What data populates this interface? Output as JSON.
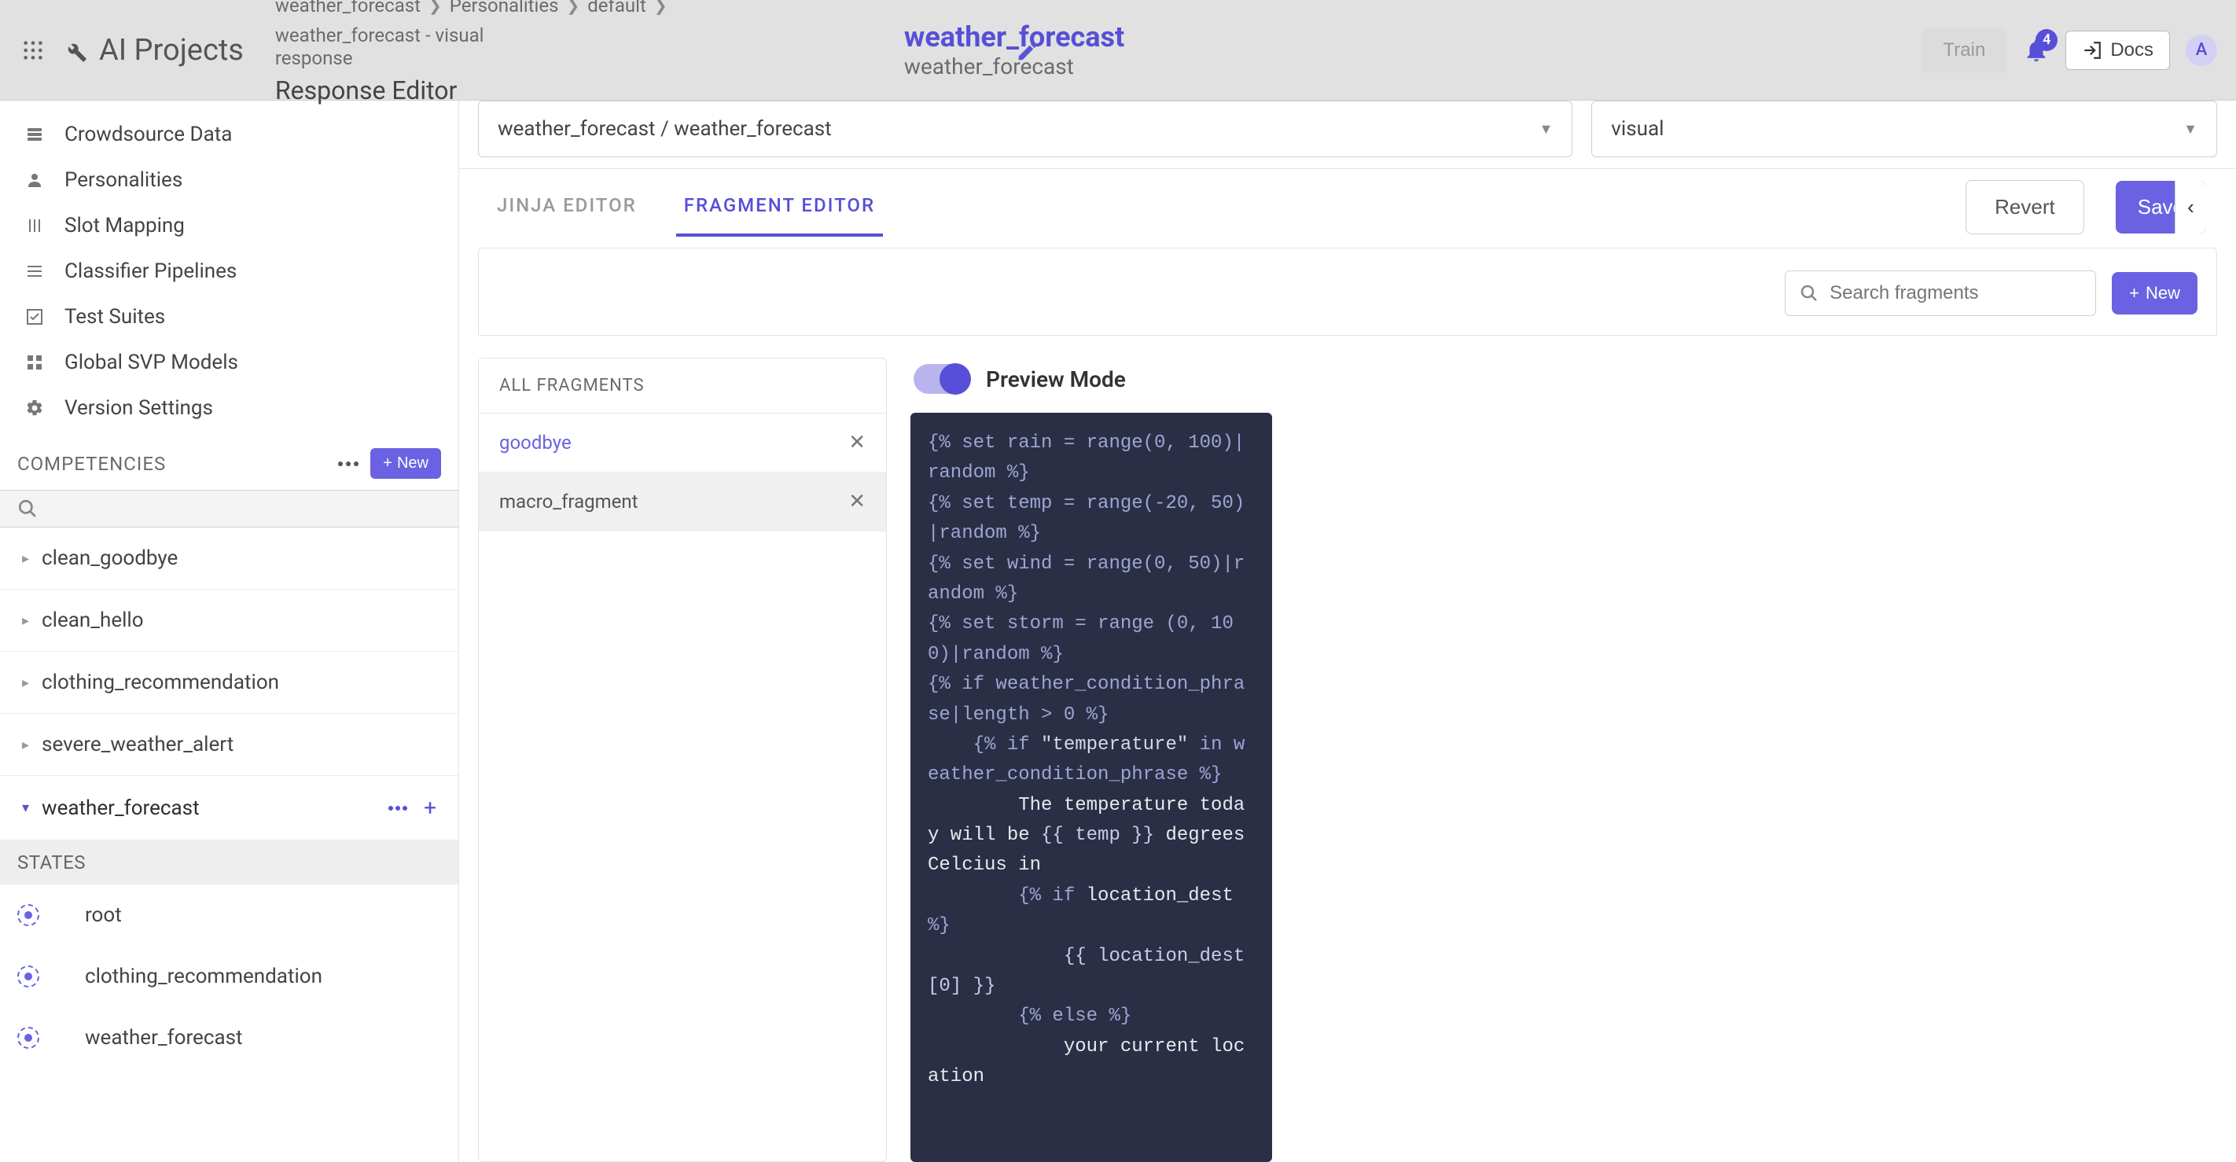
{
  "topbar": {
    "brand": "AI Projects",
    "breadcrumbs": [
      "weather_forecast",
      "Personalities",
      "default"
    ],
    "breadcrumb_last_line1": "weather_forecast - visual",
    "breadcrumb_last_line2": "response",
    "response_editor_label": "Response Editor",
    "page_title": "weather_forecast",
    "page_subtitle": "weather_forecast",
    "train_label": "Train",
    "notification_count": "4",
    "docs_label": "Docs",
    "avatar_initial": "A"
  },
  "sidebar": {
    "nav": [
      {
        "icon": "people",
        "label": "Crowdsource Data"
      },
      {
        "icon": "person",
        "label": "Personalities"
      },
      {
        "icon": "mapping",
        "label": "Slot Mapping"
      },
      {
        "icon": "pipeline",
        "label": "Classifier Pipelines"
      },
      {
        "icon": "check",
        "label": "Test Suites"
      },
      {
        "icon": "grid",
        "label": "Global SVP Models"
      },
      {
        "icon": "gear",
        "label": "Version Settings"
      }
    ],
    "competencies_label": "COMPETENCIES",
    "new_label": "New",
    "tree": [
      {
        "label": "clean_goodbye",
        "expanded": false
      },
      {
        "label": "clean_hello",
        "expanded": false
      },
      {
        "label": "clothing_recommendation",
        "expanded": false
      },
      {
        "label": "severe_weather_alert",
        "expanded": false
      },
      {
        "label": "weather_forecast",
        "expanded": true
      }
    ],
    "states_label": "STATES",
    "states": [
      {
        "label": "root",
        "indent": false
      },
      {
        "label": "clothing_recommendation",
        "indent": false
      },
      {
        "label": "weather_forecast",
        "indent": false
      }
    ]
  },
  "main": {
    "select_path": "weather_forecast / weather_forecast",
    "select_type": "visual",
    "tabs": {
      "jinja": "JINJA EDITOR",
      "fragment": "FRAGMENT EDITOR"
    },
    "revert_label": "Revert",
    "save_label": "Save",
    "search_fragments_placeholder": "Search fragments",
    "new_fragment_label": "New",
    "all_fragments_label": "ALL FRAGMENTS",
    "fragments": [
      {
        "name": "goodbye",
        "selected": true
      },
      {
        "name": "macro_fragment",
        "selected": false
      }
    ],
    "preview_mode_label": "Preview Mode",
    "preview_on": true,
    "code": {
      "l1a": "{% set rain = range(0, 100)|",
      "l1b": "random",
      "l1c": " %}",
      "l2a": "{% set temp = range(-20, 50)|",
      "l2b": "random",
      "l2c": " %}",
      "l3a": "{% set wind = range(0, 50)|",
      "l3b": "random",
      "l3c": " %}",
      "l4a": "{% set storm = range (0, 100)|",
      "l4b": "random",
      "l4c": " %}",
      "l5": "{% if weather_condition_phrase|length > 0 %}",
      "l6a": "    {% if ",
      "l6b": "\"temperature\"",
      "l6c": " in weather_condition_phrase %}",
      "l7a": "        The temperature today will be ",
      "l7b": "{{ temp }}",
      "l7c": " degrees Celcius in",
      "l8a": "        {% if ",
      "l8b": "location_dest",
      "l8c": " %}",
      "l9": "            {{ location_dest[0] }}",
      "l10": "        {% else %}",
      "l11": "            your current location"
    }
  }
}
